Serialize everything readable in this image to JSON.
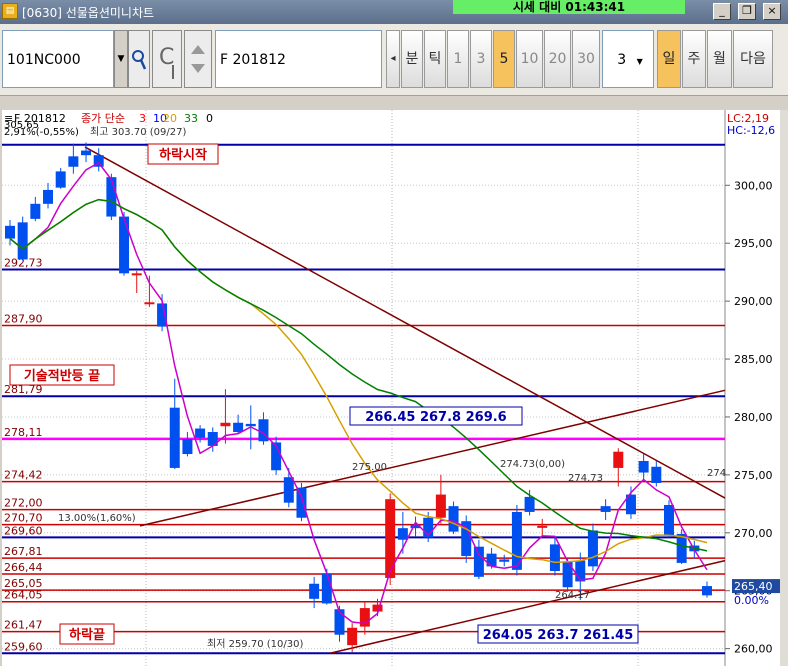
{
  "window": {
    "title": "[0630] 선물옵션미니차트",
    "banner": "시세 대비 01:43:41",
    "minimize": "_",
    "restore": "❐",
    "close": "×"
  },
  "toolbar": {
    "code": "101NC000",
    "dropdown_arrow": "▼",
    "contract": "F 201812",
    "nav_left": "◂",
    "unit_buttons": [
      {
        "label": "분",
        "active": false
      },
      {
        "label": "틱",
        "active": false
      },
      {
        "label": "1",
        "active": false
      },
      {
        "label": "3",
        "active": false
      },
      {
        "label": "5",
        "active": true
      },
      {
        "label": "10",
        "active": false
      },
      {
        "label": "20",
        "active": false
      },
      {
        "label": "30",
        "active": false
      }
    ],
    "period_value": "3",
    "period_buttons": [
      {
        "label": "일",
        "active": true
      },
      {
        "label": "주",
        "active": false
      },
      {
        "label": "월",
        "active": false
      },
      {
        "label": "다음",
        "active": false
      }
    ]
  },
  "chart_data": {
    "type": "candlestick",
    "legend": {
      "symbol": "F 201812",
      "indicator": "종가 단순",
      "ma_periods": [
        "3",
        "10",
        "20",
        "33",
        "0"
      ],
      "ma_colors": [
        "#ff0000",
        "#0000ff",
        "#d4a000",
        "#008000",
        "#000000"
      ]
    },
    "right_badges": {
      "lc": "LC:2,19",
      "hc": "HC:-12,6"
    },
    "y_axis": {
      "range": [
        258.5,
        306.5
      ],
      "ticks": [
        "300,00",
        "295,00",
        "290,00",
        "285,00",
        "280,00",
        "275,00",
        "270,00",
        "265,00",
        "260,00"
      ],
      "tick_values": [
        300,
        295,
        290,
        285,
        280,
        275,
        270,
        265,
        260
      ]
    },
    "current_price": {
      "value": 265.4,
      "label": "265,40",
      "pct": "0.00%"
    },
    "header_line": {
      "left": "2,91%(-0,55%)",
      "text": "최고 303.70 (09/27)",
      "left_price": "305,65"
    },
    "levels": [
      {
        "value": 303.5,
        "color": "#0000aa",
        "width": 2,
        "label": ""
      },
      {
        "value": 292.73,
        "color": "#0000aa",
        "width": 2,
        "label": "292,73"
      },
      {
        "value": 287.9,
        "color": "#cc0000",
        "width": 1.5,
        "label": "287,90"
      },
      {
        "value": 281.79,
        "color": "#0000aa",
        "width": 2,
        "label": "281,79"
      },
      {
        "value": 278.11,
        "color": "#ff00ff",
        "width": 2.5,
        "label": "278,11"
      },
      {
        "value": 274.42,
        "color": "#cc0000",
        "width": 1.5,
        "label": "274,42"
      },
      {
        "value": 272.0,
        "color": "#cc0000",
        "width": 1.5,
        "label": "272,00"
      },
      {
        "value": 270.7,
        "color": "#cc0000",
        "width": 1.5,
        "label": "270,70"
      },
      {
        "value": 269.6,
        "color": "#0000aa",
        "width": 2,
        "label": "269,60"
      },
      {
        "value": 267.81,
        "color": "#cc0000",
        "width": 1.5,
        "label": "267,81"
      },
      {
        "value": 266.44,
        "color": "#cc0000",
        "width": 1.5,
        "label": "266,44"
      },
      {
        "value": 265.05,
        "color": "#cc0000",
        "width": 1.5,
        "label": "265,05"
      },
      {
        "value": 264.05,
        "color": "#cc0000",
        "width": 1.5,
        "label": "264,05"
      },
      {
        "value": 261.47,
        "color": "#cc0000",
        "width": 1.5,
        "label": "261,47"
      },
      {
        "value": 259.6,
        "color": "#0000aa",
        "width": 2,
        "label": "259,60"
      }
    ],
    "annotations": [
      {
        "text": "하락시작",
        "type": "tag"
      },
      {
        "text": "기술적반등 끝",
        "type": "tag"
      },
      {
        "text": "하락끝",
        "type": "tag"
      },
      {
        "text": "266.45   267.8   269.6",
        "type": "box"
      },
      {
        "text": "264.05  263.7  261.45",
        "type": "box"
      },
      {
        "text": "275.00",
        "type": "label"
      },
      {
        "text": "274.73(0,00)",
        "type": "label"
      },
      {
        "text": "274.73",
        "type": "label"
      },
      {
        "text": "264.17",
        "type": "label"
      },
      {
        "text": "13.00%(1,60%)",
        "type": "label"
      },
      {
        "text": "최저 259.70 (10/30)",
        "type": "label"
      },
      {
        "text": "274",
        "type": "label"
      }
    ],
    "candles": [
      [
        296.5,
        297.0,
        294.8,
        295.4
      ],
      [
        296.8,
        297.3,
        293.5,
        293.6
      ],
      [
        298.4,
        299.0,
        296.9,
        297.1
      ],
      [
        299.6,
        300.2,
        298.0,
        298.4
      ],
      [
        301.2,
        301.5,
        299.7,
        299.8
      ],
      [
        302.5,
        303.6,
        301.0,
        301.6
      ],
      [
        303.0,
        303.7,
        302.0,
        302.6
      ],
      [
        302.6,
        303.2,
        301.2,
        301.6
      ],
      [
        300.7,
        301.0,
        297.0,
        297.3
      ],
      [
        297.3,
        297.7,
        292.2,
        292.4
      ],
      [
        292.4,
        292.6,
        290.7,
        292.4
      ],
      [
        289.9,
        292.2,
        289.5,
        289.9
      ],
      [
        289.8,
        290.6,
        287.4,
        287.8
      ],
      [
        280.8,
        283.3,
        275.5,
        275.6
      ],
      [
        278.1,
        278.7,
        276.6,
        276.8
      ],
      [
        279.0,
        279.3,
        277.8,
        278.2
      ],
      [
        278.7,
        279.1,
        277.0,
        277.5
      ],
      [
        279.2,
        282.4,
        277.7,
        279.5
      ],
      [
        279.5,
        280.2,
        278.5,
        278.7
      ],
      [
        279.4,
        281.0,
        277.2,
        279.2
      ],
      [
        279.8,
        280.4,
        277.6,
        277.9
      ],
      [
        277.8,
        278.3,
        275.0,
        275.4
      ],
      [
        274.8,
        275.6,
        272.2,
        272.6
      ],
      [
        273.9,
        274.3,
        271.0,
        271.3
      ],
      [
        265.6,
        266.2,
        263.5,
        264.3
      ],
      [
        266.5,
        266.9,
        263.8,
        263.9
      ],
      [
        263.4,
        263.7,
        260.6,
        261.2
      ],
      [
        260.3,
        262.2,
        259.7,
        261.8
      ],
      [
        261.9,
        264.0,
        261.2,
        263.5
      ],
      [
        263.2,
        264.3,
        262.8,
        263.8
      ],
      [
        266.1,
        273.4,
        265.5,
        272.9
      ],
      [
        270.4,
        271.8,
        268.2,
        269.4
      ],
      [
        270.7,
        271.4,
        269.7,
        270.4
      ],
      [
        271.3,
        271.8,
        269.2,
        269.6
      ],
      [
        271.3,
        275.0,
        270.8,
        273.3
      ],
      [
        272.3,
        272.7,
        269.9,
        270.1
      ],
      [
        271.0,
        271.5,
        267.4,
        268.0
      ],
      [
        268.8,
        269.4,
        266.0,
        266.2
      ],
      [
        268.2,
        268.7,
        266.9,
        267.1
      ],
      [
        267.7,
        268.1,
        267.1,
        267.5
      ],
      [
        271.8,
        272.4,
        266.3,
        266.8
      ],
      [
        273.1,
        273.7,
        271.5,
        271.8
      ],
      [
        270.5,
        271.2,
        269.7,
        270.6
      ],
      [
        269.0,
        269.6,
        266.3,
        266.7
      ],
      [
        267.5,
        267.8,
        264.9,
        265.3
      ],
      [
        267.6,
        268.3,
        264.2,
        265.8
      ],
      [
        270.2,
        270.8,
        266.7,
        267.1
      ],
      [
        272.3,
        272.9,
        271.1,
        271.8
      ],
      [
        275.6,
        277.3,
        274.0,
        277.0
      ],
      [
        273.3,
        274.0,
        271.2,
        271.6
      ],
      [
        276.2,
        276.8,
        274.5,
        275.2
      ],
      [
        275.7,
        276.2,
        274.0,
        274.3
      ],
      [
        272.4,
        272.8,
        269.6,
        269.8
      ],
      [
        269.9,
        270.3,
        267.3,
        267.4
      ],
      [
        268.9,
        269.3,
        267.8,
        268.4
      ],
      [
        265.4,
        265.8,
        264.4,
        264.6
      ]
    ]
  }
}
